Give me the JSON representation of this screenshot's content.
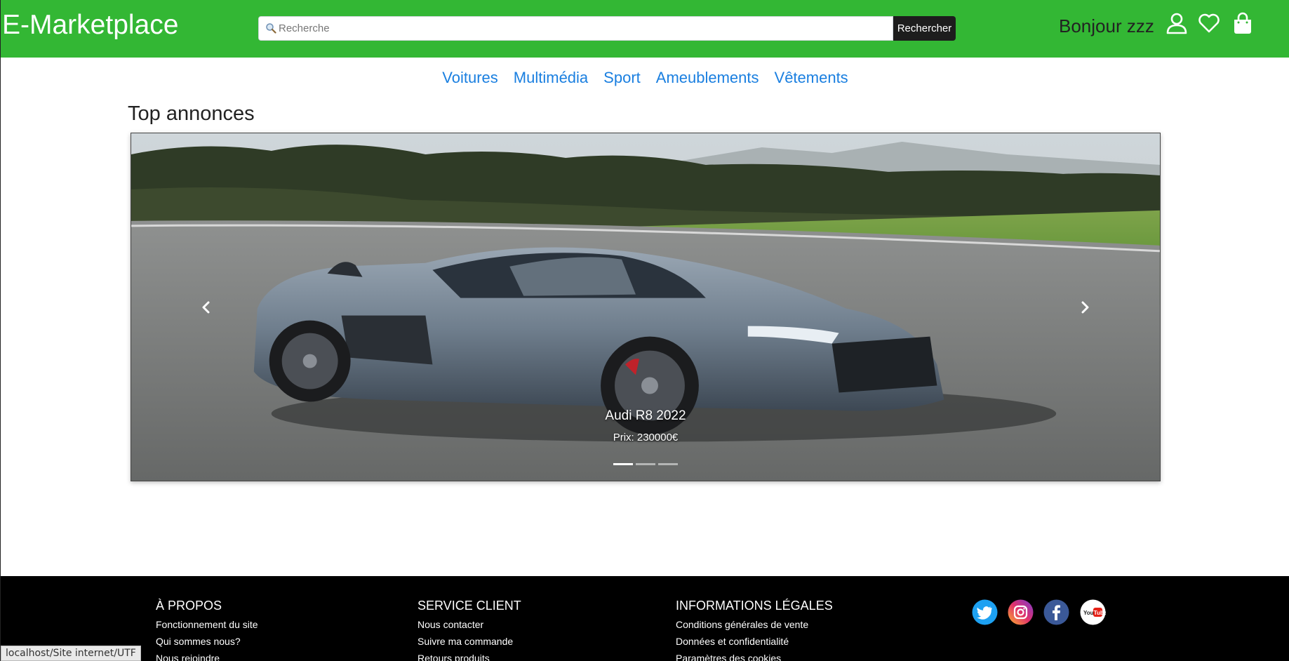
{
  "header": {
    "brand": "E-Marketplace",
    "search": {
      "placeholder": "Recherche",
      "button_label": "Rechercher"
    },
    "greeting": "Bonjour zzz",
    "icons": [
      "user-icon",
      "heart-icon",
      "shopping-bag-icon"
    ]
  },
  "categories": [
    "Voitures",
    "Multimédia",
    "Sport",
    "Ameublements",
    "Vêtements"
  ],
  "main": {
    "section_title": "Top annonces",
    "carousel": {
      "title": "Audi R8 2022",
      "price": "Prix: 230000€",
      "slide_count": 3,
      "active_index": 0
    }
  },
  "footer": {
    "columns": [
      {
        "heading": "À PROPOS",
        "links": [
          "Fonctionnement du site",
          "Qui sommes nous?",
          "Nous rejoindre"
        ]
      },
      {
        "heading": "SERVICE CLIENT",
        "links": [
          "Nous contacter",
          "Suivre ma commande",
          "Retours produits"
        ]
      },
      {
        "heading": "INFORMATIONS LÉGALES",
        "links": [
          "Conditions générales de vente",
          "Données et confidentialité",
          "Paramètres des cookies"
        ]
      }
    ],
    "social": [
      "twitter-icon",
      "instagram-icon",
      "facebook-icon",
      "youtube-icon"
    ]
  },
  "status_bar": "localhost/Site internet/UTF",
  "colors": {
    "header_bg": "#33b734",
    "link": "#1a7fe0",
    "footer_bg": "#000000",
    "search_button_bg": "#1d1d1d"
  }
}
